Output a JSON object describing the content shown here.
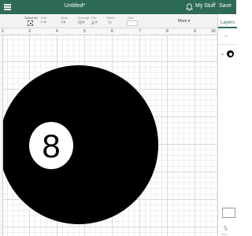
{
  "header": {
    "title": "Untitled*",
    "my_stuff": "My Stuff",
    "save": "Save",
    "bar_color": "#2d6a57"
  },
  "toolbar": {
    "select_all": "Select All",
    "edit": "Edit",
    "align": "Align",
    "arrange": "Arrange",
    "flip": "Flip",
    "offset": "Offset",
    "size": "Size",
    "more": "More ▾"
  },
  "ruler": {
    "marks": [
      "2",
      "3",
      "4",
      "5",
      "6",
      "7",
      "8",
      "9",
      "10"
    ]
  },
  "canvas": {
    "ball_number": "8",
    "ball_color": "#000000"
  },
  "panel": {
    "layers_tab": "Layers",
    "bottom_label": "Sync"
  }
}
